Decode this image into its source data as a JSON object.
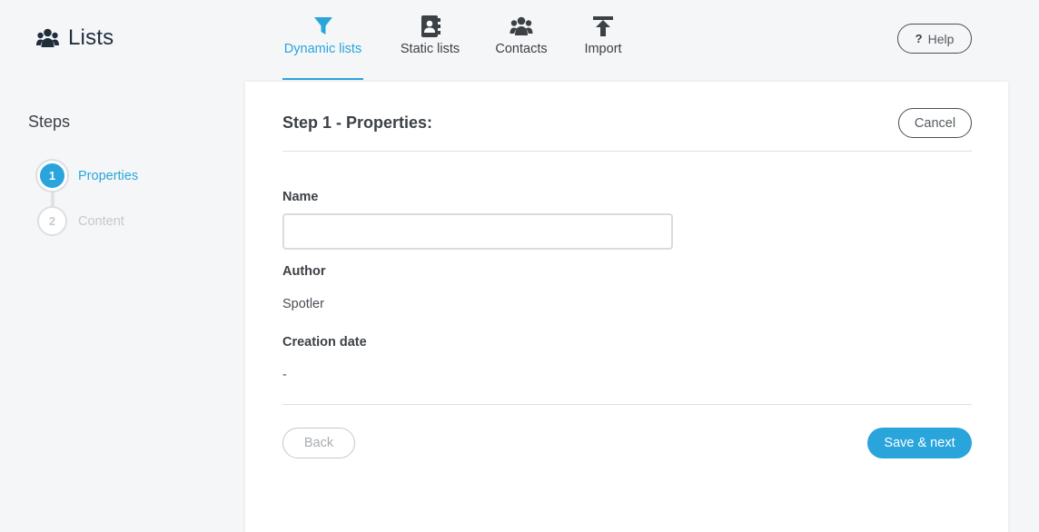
{
  "app": {
    "title": "Lists",
    "icon": "users-icon"
  },
  "nav": {
    "items": [
      {
        "label": "Dynamic lists",
        "icon": "filter-icon",
        "active": true
      },
      {
        "label": "Static lists",
        "icon": "address-book-icon",
        "active": false
      },
      {
        "label": "Contacts",
        "icon": "users-icon",
        "active": false
      },
      {
        "label": "Import",
        "icon": "upload-icon",
        "active": false
      }
    ]
  },
  "help": {
    "icon_text": "?",
    "label": "Help"
  },
  "sidebar": {
    "title": "Steps",
    "steps": [
      {
        "number": "1",
        "label": "Properties",
        "state": "active"
      },
      {
        "number": "2",
        "label": "Content",
        "state": "inactive"
      }
    ]
  },
  "form": {
    "title": "Step 1 - Properties:",
    "cancel_label": "Cancel",
    "name_label": "Name",
    "name_value": "",
    "author_label": "Author",
    "author_value": "Spotler",
    "date_label": "Creation date",
    "date_value": "-",
    "back_label": "Back",
    "save_label": "Save & next"
  },
  "colors": {
    "accent": "#29a5dc",
    "text": "#3c4146",
    "background": "#f5f6f8"
  }
}
